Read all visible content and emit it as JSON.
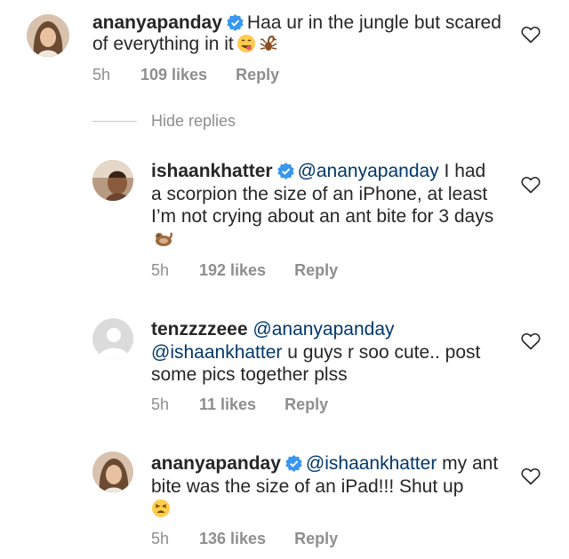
{
  "comments": [
    {
      "username": "ananyapanday",
      "verified": true,
      "mentions": [],
      "text": "Haa ur in the jungle but scared of everything in it",
      "emoji": [
        "yum-face-emoji",
        "scorpion-emoji"
      ],
      "time": "5h",
      "likes": "109 likes",
      "reply": "Reply"
    },
    {
      "username": "ishaankhatter",
      "verified": true,
      "mention": "@ananyapanday",
      "text": "I had a scorpion the size of an iPhone, at least I’m not crying about an ant bite for 3 days",
      "emoji": [
        "otter-emoji"
      ],
      "time": "5h",
      "likes": "192 likes",
      "reply": "Reply"
    },
    {
      "username": "tenzzzzeee",
      "verified": false,
      "mention1": "@ananyapanday",
      "mention2": "@ishaankhatter",
      "text": "u guys r soo cute.. post some pics together plss",
      "time": "5h",
      "likes": "11 likes",
      "reply": "Reply"
    },
    {
      "username": "ananyapanday",
      "verified": true,
      "mention": "@ishaankhatter",
      "text": "my ant bite was the size of an iPad!!! Shut up",
      "emoji": [
        "tired-face-emoji"
      ],
      "time": "5h",
      "likes": "136 likes",
      "reply": "Reply"
    }
  ],
  "hide_replies": "Hide replies",
  "colors": {
    "text": "#262626",
    "meta": "#8e8e8e",
    "mention": "#00376b",
    "verified": "#3897f0"
  }
}
